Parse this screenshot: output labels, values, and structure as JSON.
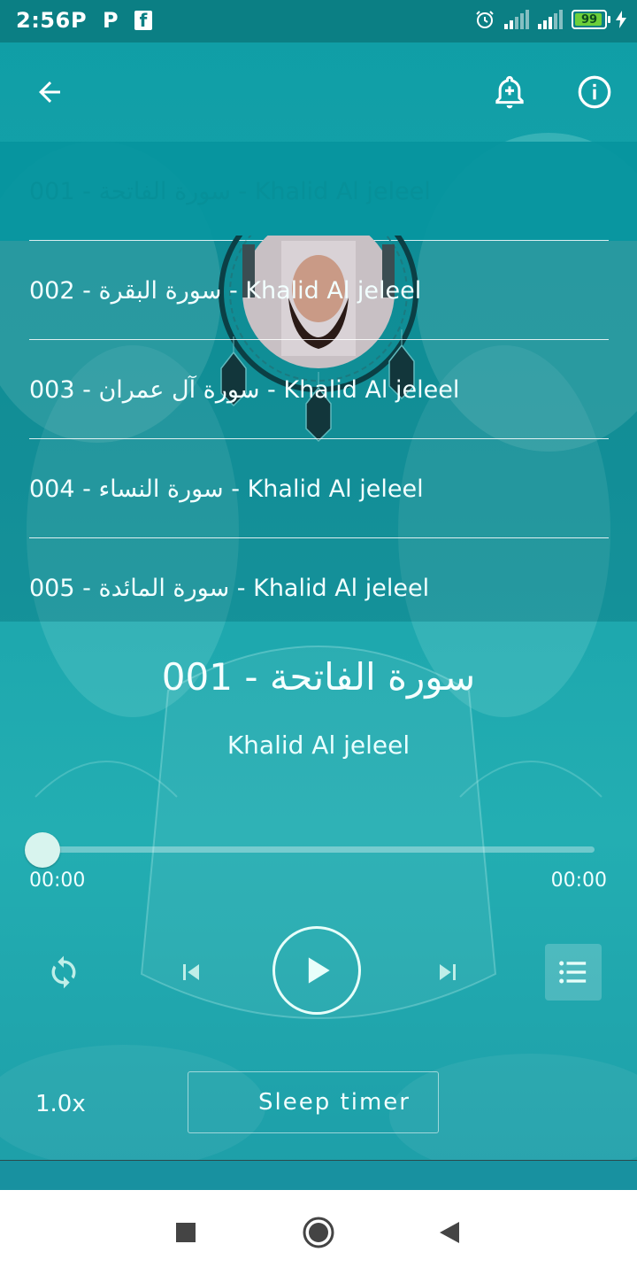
{
  "status_bar": {
    "time": "2:56",
    "app_icons": [
      "P",
      "P",
      "f"
    ],
    "battery": "99"
  },
  "toolbar": {
    "back_icon": "arrow-left-icon",
    "alarm_icon": "bell-plus-icon",
    "info_icon": "info-circle-icon"
  },
  "playlist": {
    "items": [
      {
        "label": "001 - سورة الفاتحة - Khalid Al jeleel",
        "selected": true
      },
      {
        "label": "002 - سورة البقرة - Khalid Al jeleel",
        "selected": false
      },
      {
        "label": "003 - سورة آل عمران - Khalid Al jeleel",
        "selected": false
      },
      {
        "label": "004 - سورة النساء - Khalid Al jeleel",
        "selected": false
      },
      {
        "label": "005 - سورة المائدة - Khalid Al jeleel",
        "selected": false
      }
    ]
  },
  "now_playing": {
    "title": "001 - سورة الفاتحة",
    "artist": "Khalid Al jeleel",
    "elapsed": "00:00",
    "duration": "00:00",
    "progress": 0
  },
  "controls": {
    "repeat_icon": "repeat-icon",
    "previous_icon": "skip-previous-icon",
    "play_icon": "play-icon",
    "next_icon": "skip-next-icon",
    "queue_icon": "playlist-icon"
  },
  "footer": {
    "speed": "1.0x",
    "sleep_timer_label": "Sleep timer",
    "sleep_icon": "moon-icon"
  },
  "colors": {
    "accent": "#0f9ea6",
    "status_bar": "#0b7f84",
    "selected_row": "#0696a0"
  }
}
